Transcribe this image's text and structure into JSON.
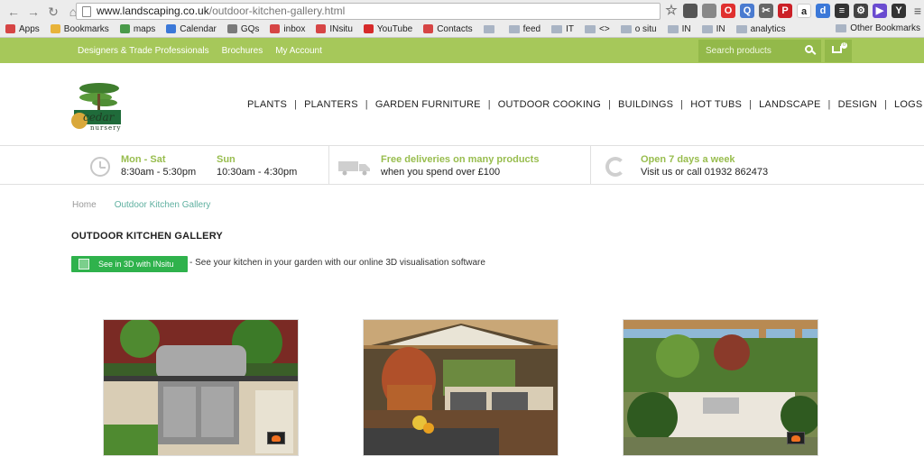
{
  "browser": {
    "url_host": "www.landscaping.co.uk",
    "url_path": "/outdoor-kitchen-gallery.html",
    "bookmarks": [
      {
        "label": "Apps",
        "color": "#d64545"
      },
      {
        "label": "Bookmarks",
        "color": "#e8b33a"
      },
      {
        "label": "maps",
        "color": "#4a9a4a"
      },
      {
        "label": "Calendar",
        "color": "#3b78d8"
      },
      {
        "label": "GQs",
        "color": "#7a7a7a"
      },
      {
        "label": "inbox",
        "color": "#d64545"
      },
      {
        "label": "INsitu",
        "color": "#d64545"
      },
      {
        "label": "YouTube",
        "color": "#d62a2a"
      },
      {
        "label": "Contacts",
        "color": "#d64545"
      },
      {
        "label": "",
        "color": "folder"
      },
      {
        "label": "feed",
        "color": "folder"
      },
      {
        "label": "IT",
        "color": "folder"
      },
      {
        "label": "<>",
        "color": "folder"
      },
      {
        "label": "o situ",
        "color": "folder"
      },
      {
        "label": "IN",
        "color": "folder"
      },
      {
        "label": "IN",
        "color": "folder"
      },
      {
        "label": "analytics",
        "color": "folder"
      }
    ],
    "other_bookmarks": "Other Bookmarks",
    "colors": {
      "opera": "#e0302f",
      "pinterest": "#cb2027",
      "amazon": "#222222",
      "q": "#4a7bd0"
    }
  },
  "topbar": {
    "links": [
      "Designers & Trade Professionals",
      "Brochures",
      "My Account"
    ],
    "search_placeholder": "Search products",
    "cart_count": "0",
    "color": "#a6c85a"
  },
  "logo": {
    "text_top": "cedar",
    "text_bottom": "nursery"
  },
  "nav": [
    "PLANTS",
    "PLANTERS",
    "GARDEN FURNITURE",
    "OUTDOOR COOKING",
    "BUILDINGS",
    "HOT TUBS",
    "LANDSCAPE",
    "DESIGN",
    "LOGS"
  ],
  "info": {
    "weekday_label": "Mon - Sat",
    "weekday_hours": "8:30am - 5:30pm",
    "sunday_label": "Sun",
    "sunday_hours": "10:30am - 4:30pm",
    "delivery_title": "Free deliveries on many products",
    "delivery_text": "when you spend over £100",
    "open_title": "Open 7 days a week",
    "open_text": "Visit us or call 01932 862473"
  },
  "breadcrumb": {
    "home": "Home",
    "current": "Outdoor Kitchen Gallery"
  },
  "page": {
    "title": "OUTDOOR KITCHEN GALLERY",
    "insitu_button": "See in 3D with INsitu",
    "insitu_text": "- See your kitchen in your garden with our online 3D visualisation software"
  }
}
